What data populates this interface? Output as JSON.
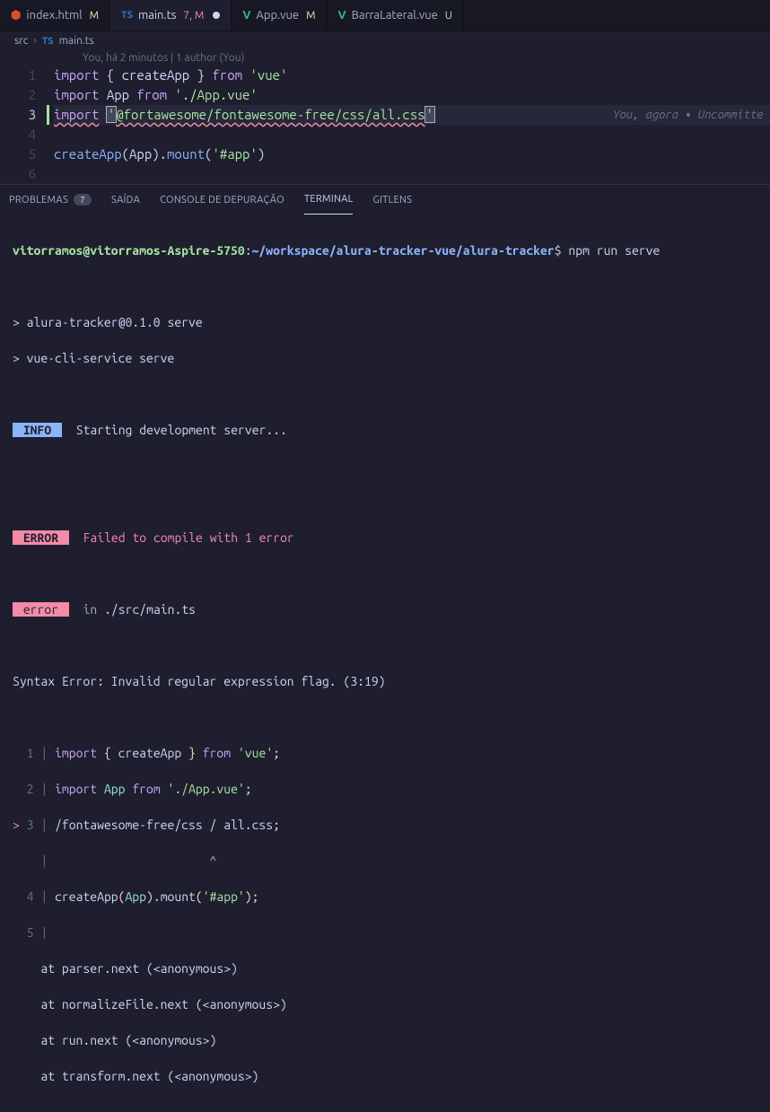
{
  "tabs": [
    {
      "icon": "html5",
      "name": "index.html",
      "status": "M",
      "statusClass": "status-m"
    },
    {
      "icon": "ts",
      "name": "main.ts",
      "status": "7, M",
      "statusClass": "status-err",
      "active": true,
      "dirty": true
    },
    {
      "icon": "vue",
      "name": "App.vue",
      "status": "M",
      "statusClass": "status-m"
    },
    {
      "icon": "vue",
      "name": "BarraLateral.vue",
      "status": "U",
      "statusClass": "status-u"
    }
  ],
  "breadcrumb": {
    "p1": "src",
    "p2": "main.ts",
    "icon": "TS"
  },
  "codelens": "You, há 2 minutos | 1 author (You)",
  "editor": {
    "lines": {
      "l1": {
        "import": "import",
        "brace_o": " { ",
        "create": "createApp",
        "brace_c": " } ",
        "from": "from",
        "sp": " ",
        "q1": "'",
        "mod": "vue",
        "q2": "'"
      },
      "l2": {
        "import": "import",
        "sp1": " ",
        "app": "App",
        "sp2": " ",
        "from": "from",
        "sp3": " ",
        "q1": "'",
        "mod": "./App.vue",
        "q2": "'"
      },
      "l3": {
        "import": "import",
        "sp": " ",
        "q1": "'",
        "mod": "@fortawesome/fontawesome-free/css/all.css",
        "q2": "'"
      },
      "l5": {
        "create": "createApp",
        "po": "(",
        "app": "App",
        "pc": ")",
        "dot": ".",
        "mount": "mount",
        "po2": "(",
        "q1": "'",
        "sel": "#app",
        "q2": "'",
        "pc2": ")"
      }
    },
    "blame": "You, agora • Uncommitte"
  },
  "panel": {
    "tabs": {
      "problems": "PROBLEMAS",
      "problems_count": "7",
      "output": "SAÍDA",
      "debug": "CONSOLE DE DEPURAÇÃO",
      "terminal": "TERMINAL",
      "gitlens": "GITLENS"
    }
  },
  "terminal": {
    "prompt_user": "vitorramos@vitorramos-Aspire-5750",
    "prompt_colon": ":",
    "prompt_path": "~/workspace/alura-tracker-vue/alura-tracker",
    "prompt_dollar": "$",
    "cmd": " npm run serve",
    "out1": "> alura-tracker@0.1.0 serve",
    "out2": "> vue-cli-service serve",
    "info_tag": " INFO ",
    "info_text": "  Starting development server...",
    "error_tag": " ERROR ",
    "error_text": "  Failed to compile with 1 error",
    "error_sm": " error ",
    "error_in": "  in ",
    "error_file": "./src/main.ts",
    "syntax": "Syntax Error: Invalid regular expression flag. (3:19)",
    "src": {
      "l1": {
        "n": "  1",
        "bar": " | ",
        "import": "import",
        "sp1": " ",
        "bo": "{",
        "sp2": " ",
        "create": "createApp",
        "sp3": " ",
        "bc": "}",
        "sp4": " ",
        "from": "from",
        "sp5": " ",
        "str": "'vue'",
        "semi": ";"
      },
      "l2": {
        "n": "  2",
        "bar": " | ",
        "import": "import",
        "sp1": " ",
        "app": "App",
        "sp2": " ",
        "from": "from",
        "sp3": " ",
        "str": "'./App.vue'",
        "semi": ";"
      },
      "l3": {
        "gt": ">",
        "n": " 3",
        "bar": " | ",
        "text": "/fontawesome-free/css / all.css;"
      },
      "caret_line": "    |                       ",
      "caret": "^",
      "l4": {
        "n": "  4",
        "bar": " | ",
        "create": "createApp",
        "po": "(",
        "app": "App",
        "pc": ")",
        "dot": ".",
        "mount": "mount",
        "po2": "(",
        "str": "'#app'",
        "pc2": ")",
        "semi": ";"
      },
      "l5": {
        "n": "  5",
        "bar": " | "
      }
    },
    "stack": [
      "    at parser.next (<anonymous>)",
      "    at normalizeFile.next (<anonymous>)",
      "    at run.next (<anonymous>)",
      "    at transform.next (<anonymous>)"
    ]
  }
}
